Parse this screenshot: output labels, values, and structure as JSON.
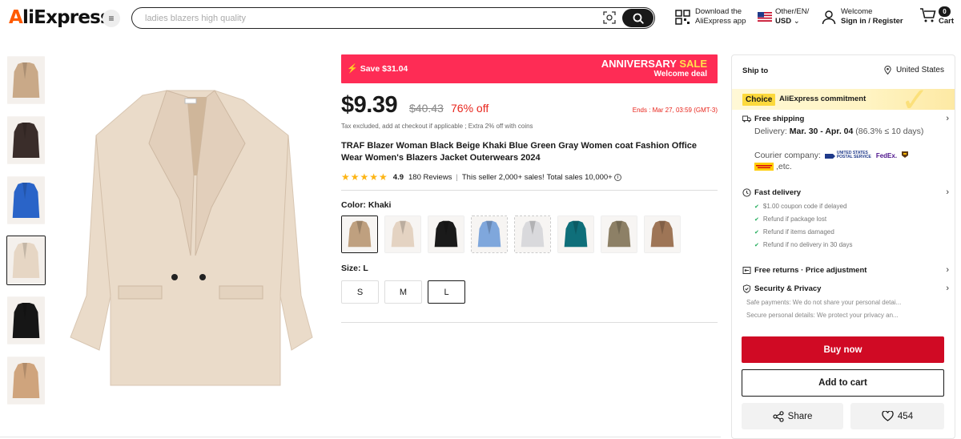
{
  "header": {
    "logo": "AliExpress",
    "search_placeholder": "ladies blazers high quality",
    "download_line1": "Download the",
    "download_line2": "AliExpress app",
    "region_line1": "Other/EN/",
    "region_line2": "USD",
    "welcome_line1": "Welcome",
    "welcome_line2": "Sign in / Register",
    "cart_label": "Cart",
    "cart_count": "0"
  },
  "gallery": {
    "thumb_colors": [
      "#c9a988",
      "#3a2d2a",
      "#2a64c8",
      "#e6d6c4",
      "#161616",
      "#cfa47d"
    ],
    "selected_index": 3,
    "main_color": "#eadbc9"
  },
  "promo": {
    "save": "Save $31.04",
    "anniversary": "ANNIVERSARY",
    "sale": "SALE",
    "welcome_deal": "Welcome deal",
    "bg_color": "#fe2c55"
  },
  "price": {
    "current": "$9.39",
    "original": "$40.43",
    "discount": "76% off",
    "ends": "Ends :  Mar 27, 03:59 (GMT-3)",
    "tax_note": "Tax excluded, add at checkout if applicable ; Extra 2% off with coins"
  },
  "product": {
    "title": "TRAF Blazer Woman Black Beige Khaki Blue Green Gray Women coat Fashion Office Wear Women's Blazers Jacket Outerwears 2024",
    "rating": "4.9",
    "reviews": "180 Reviews",
    "sales_note": "This seller 2,000+ sales!",
    "total_sales": "Total sales 10,000+"
  },
  "options": {
    "color_label": "Color: Khaki",
    "colors": [
      {
        "name": "Khaki",
        "hex": "#bfa07f"
      },
      {
        "name": "Beige",
        "hex": "#e4d3c2"
      },
      {
        "name": "Black",
        "hex": "#1a1a1a"
      },
      {
        "name": "Blue",
        "hex": "#7fa7dc"
      },
      {
        "name": "Gray",
        "hex": "#d9d9dc"
      },
      {
        "name": "Green",
        "hex": "#0f6f7a"
      },
      {
        "name": "Olive",
        "hex": "#8d8066"
      },
      {
        "name": "Brown",
        "hex": "#9e7556"
      }
    ],
    "size_label": "Size: L",
    "sizes": [
      "S",
      "M",
      "L"
    ],
    "selected_size": "L"
  },
  "panel": {
    "ship_to": "Ship to",
    "location": "United States",
    "choice_tag": "Choice",
    "commitment": "AliExpress commitment",
    "free_shipping": "Free shipping",
    "delivery_prefix": "Delivery: ",
    "delivery_dates": "Mar. 30 - Apr. 04",
    "delivery_suffix": " (86.3% ≤ 10 days)",
    "courier_label": "Courier company:",
    "courier_usps": "UNITED STATES POSTAL SERVICE",
    "courier_fedex": "FedEx.",
    "courier_etc": ",etc.",
    "fast_delivery": "Fast delivery",
    "fast_items": [
      "$1.00 coupon code if delayed",
      "Refund if package lost",
      "Refund if items damaged",
      "Refund if no delivery in 30 days"
    ],
    "free_returns": "Free returns · Price adjustment",
    "security": "Security & Privacy",
    "safe_payments": "Safe payments: We do not share your personal detai...",
    "secure_details": "Secure personal details: We protect your privacy an...",
    "buy_now": "Buy now",
    "add_to_cart": "Add to cart",
    "share": "Share",
    "wishlist_count": "454"
  }
}
